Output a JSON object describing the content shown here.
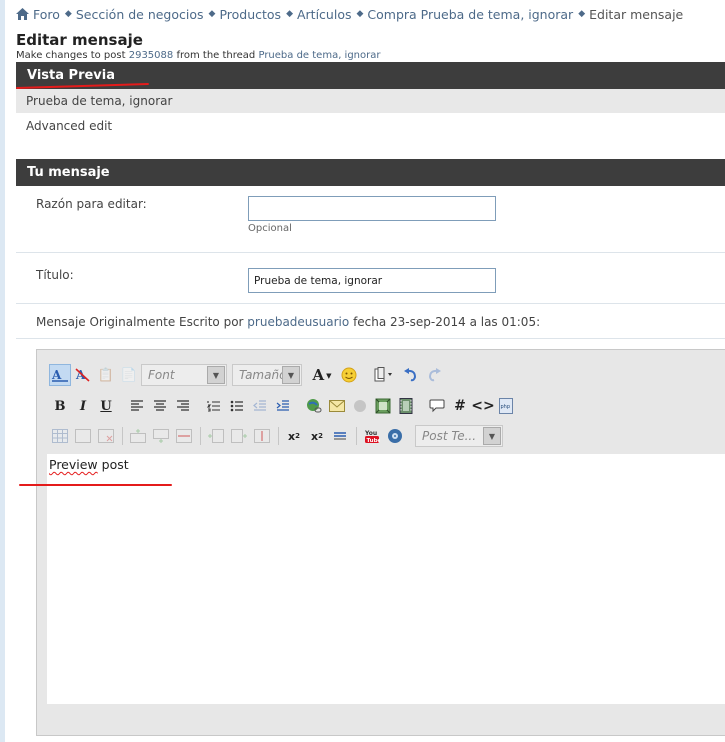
{
  "breadcrumb": {
    "items": [
      "Foro",
      "Sección de negocios",
      "Productos",
      "Artículos",
      "Compra Prueba de tema, ignorar"
    ],
    "current": "Editar mensaje"
  },
  "header": {
    "title": "Editar mensaje",
    "desc_prefix": "Make changes to post",
    "post_id": "2935088",
    "desc_middle": "from the thread",
    "thread_title": "Prueba de tema, ignorar"
  },
  "preview": {
    "section_title": "Vista Previa",
    "post_title": "Prueba de tema, ignorar",
    "advanced_edit": "Advanced edit"
  },
  "message": {
    "section_title": "Tu mensaje",
    "reason_label": "Razón para editar:",
    "reason_value": "",
    "reason_hint": "Opcional",
    "title_label": "Título:",
    "title_value": "Prueba de tema, ignorar",
    "original": {
      "prefix": "Mensaje Originalmente Escrito por",
      "author": "pruebadeusuario",
      "suffix": "fecha 23-sep-2014 a las 01:05:"
    }
  },
  "editor": {
    "font_placeholder": "Font",
    "size_placeholder": "Tamaño",
    "post_template_placeholder": "Post Te...",
    "bold": "B",
    "italic": "I",
    "underline": "U",
    "text_first": "Preview",
    "text_rest": " post"
  },
  "colors": {
    "header_bg": "#3d3d3d",
    "link": "#4d6a89",
    "annotation_red": "#e41b1b"
  }
}
